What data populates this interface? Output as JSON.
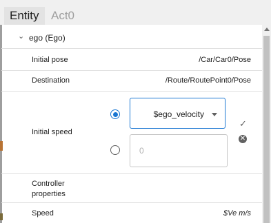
{
  "tabs": [
    {
      "label": "Entity"
    },
    {
      "label": "Act0"
    }
  ],
  "group": {
    "chevron": "⌄",
    "label": "ego (Ego)"
  },
  "rows": {
    "initial_pose": {
      "label": "Initial pose",
      "value": "/Car/Car0/Pose"
    },
    "destination": {
      "label": "Destination",
      "value": "/Route/RoutePoint0/Pose"
    },
    "initial_speed": {
      "label": "Initial speed",
      "select_value": "$ego_velocity",
      "input_value": "0",
      "selected_option": "parameter"
    },
    "controller": {
      "label_line1": "Controller",
      "label_line2": "properties"
    },
    "speed": {
      "label": "Speed",
      "value": "$Ve m/s"
    }
  },
  "icons": {
    "confirm": "check-icon",
    "cancel": "cancel-icon",
    "dropdown": "chevron-down-icon"
  },
  "colors": {
    "accent": "#1976d2",
    "tab_active_bg": "#e3e3e3",
    "tab_inactive_text": "#9e9e9e"
  }
}
